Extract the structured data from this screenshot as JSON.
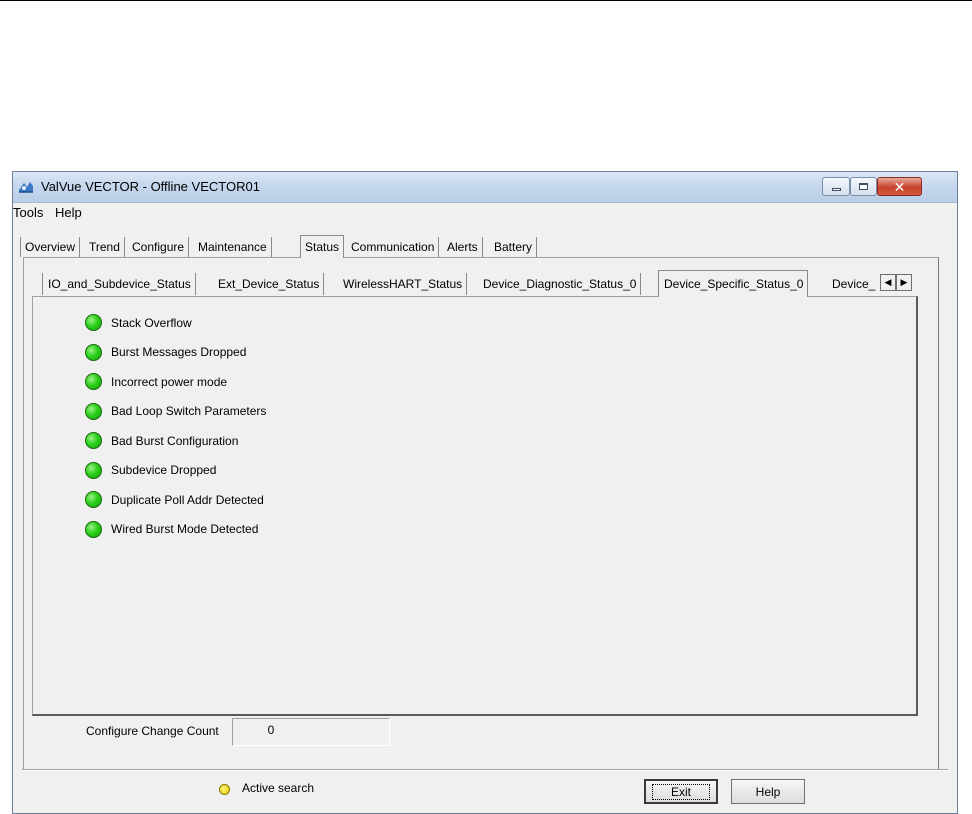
{
  "window": {
    "title": "ValVue VECTOR - Offline  VECTOR01",
    "controls": [
      "minimize",
      "maximize",
      "close"
    ]
  },
  "menu": {
    "items": [
      {
        "label": "Tools"
      },
      {
        "label": "Help"
      }
    ]
  },
  "main_tabs": [
    {
      "label": "Overview"
    },
    {
      "label": "Trend"
    },
    {
      "label": "Configure"
    },
    {
      "label": "Maintenance"
    },
    {
      "label": "Status",
      "active": true
    },
    {
      "label": "Communication"
    },
    {
      "label": "Alerts"
    },
    {
      "label": "Battery"
    }
  ],
  "sub_tabs": [
    {
      "label": "IO_and_Subdevice_Status"
    },
    {
      "label": "Ext_Device_Status"
    },
    {
      "label": "WirelessHART_Status"
    },
    {
      "label": "Device_Diagnostic_Status_0"
    },
    {
      "label": "Device_Specific_Status_0",
      "active": true
    },
    {
      "label": "Device_"
    }
  ],
  "status_items": [
    {
      "label": "Stack Overflow",
      "state_color": "#2bd01a"
    },
    {
      "label": "Burst Messages Dropped",
      "state_color": "#2bd01a"
    },
    {
      "label": "Incorrect power mode",
      "state_color": "#2bd01a"
    },
    {
      "label": "Bad Loop Switch Parameters",
      "state_color": "#2bd01a"
    },
    {
      "label": "Bad Burst Configuration",
      "state_color": "#2bd01a"
    },
    {
      "label": "Subdevice Dropped",
      "state_color": "#2bd01a"
    },
    {
      "label": "Duplicate Poll Addr Detected",
      "state_color": "#2bd01a"
    },
    {
      "label": "Wired Burst Mode Detected",
      "state_color": "#2bd01a"
    }
  ],
  "change_count": {
    "label": "Configure Change Count",
    "value": "0"
  },
  "footer": {
    "search_status": "Active search",
    "search_indicator_color": "#e6c800",
    "exit_label": "Exit",
    "help_label": "Help"
  }
}
